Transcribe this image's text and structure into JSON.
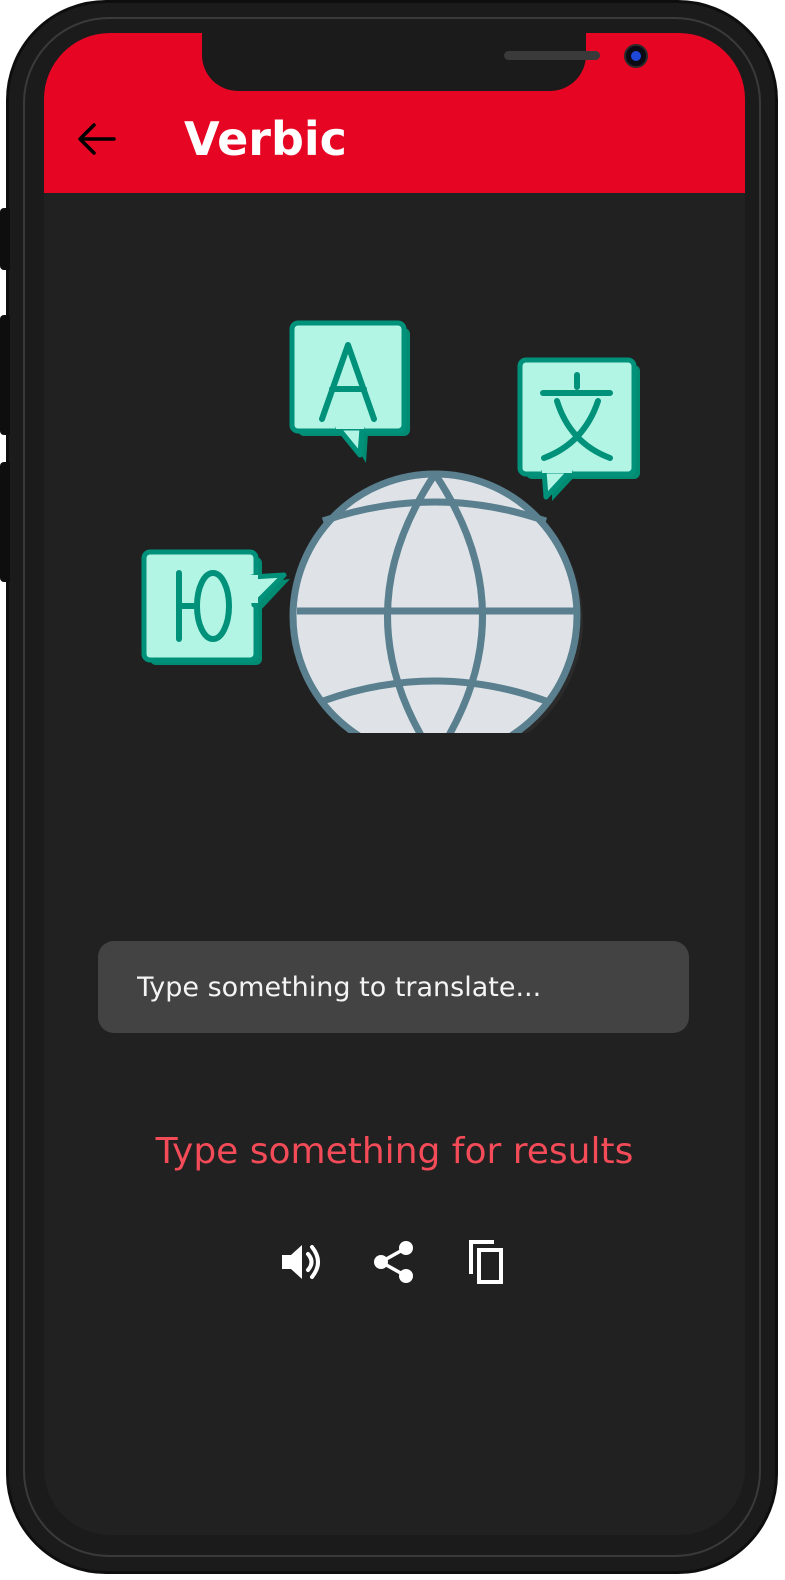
{
  "app": {
    "title": "Verbic",
    "accent_color": "#e60523",
    "background_color": "#212121"
  },
  "toolbar": {
    "back_icon": "arrow-left-icon"
  },
  "illustration": {
    "icons": [
      "globe-icon",
      "speech-bubble-latin-a-icon",
      "speech-bubble-chinese-icon",
      "speech-bubble-cyrillic-icon"
    ],
    "glyphs": {
      "latin": "A",
      "chinese": "文",
      "cyrillic": "Ю"
    }
  },
  "translate_input": {
    "value": "",
    "placeholder": "Type something to translate..."
  },
  "result": {
    "text": "Type something for results",
    "color": "#f34b57"
  },
  "actions": [
    {
      "icon": "volume-up-icon"
    },
    {
      "icon": "share-icon"
    },
    {
      "icon": "copy-icon"
    }
  ]
}
